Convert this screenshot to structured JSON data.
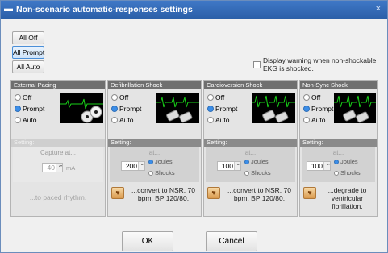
{
  "window": {
    "title": "Non-scenario automatic-responses settings",
    "close_glyph": "×"
  },
  "quick": {
    "all_off": "All Off",
    "all_prompt": "All Prompt",
    "all_auto": "All Auto"
  },
  "warning": {
    "label": "Display warning when non-shockable EKG is shocked.",
    "checked": false
  },
  "panels": [
    {
      "title": "External Pacing",
      "options": [
        "Off",
        "Prompt",
        "Auto"
      ],
      "selected": "Prompt",
      "setting_label": "Setting:",
      "at_label": "Capture at...",
      "value": "40",
      "unit": "mA",
      "result": "...to paced rhythm.",
      "disabled": true
    },
    {
      "title": "Defibrillation Shock",
      "options": [
        "Off",
        "Prompt",
        "Auto"
      ],
      "selected": "Prompt",
      "setting_label": "Setting:",
      "at_label": "at...",
      "value": "200",
      "units": [
        "Joules",
        "Shocks"
      ],
      "selected_unit": "Joules",
      "result": "...convert to NSR, 70 bpm, BP 120/80.",
      "disabled": false
    },
    {
      "title": "Cardioversion Shock",
      "options": [
        "Off",
        "Prompt",
        "Auto"
      ],
      "selected": "Prompt",
      "setting_label": "Setting:",
      "at_label": "at...",
      "value": "100",
      "units": [
        "Joules",
        "Shocks"
      ],
      "selected_unit": "Joules",
      "result": "...convert to NSR, 70 bpm, BP 120/80.",
      "disabled": false
    },
    {
      "title": "Non-Sync Shock",
      "options": [
        "Off",
        "Prompt",
        "Auto"
      ],
      "selected": "Prompt",
      "setting_label": "Setting:",
      "at_label": "at...",
      "value": "100",
      "units": [
        "Joules",
        "Shocks"
      ],
      "selected_unit": "Joules",
      "result": "...degrade to ventricular fibrillation.",
      "disabled": false
    }
  ],
  "footer": {
    "ok": "OK",
    "cancel": "Cancel"
  },
  "colors": {
    "title_bar": "#2f66b3",
    "panel_header": "#6f6f6f",
    "ekg_trace": "#18d018",
    "selected_radio": "#3c8ee8"
  },
  "icons": [
    "heart-monitor-icon",
    "pacing-pads-icon",
    "defib-paddles-icon",
    "rhythm-result-icon",
    "close-icon"
  ]
}
